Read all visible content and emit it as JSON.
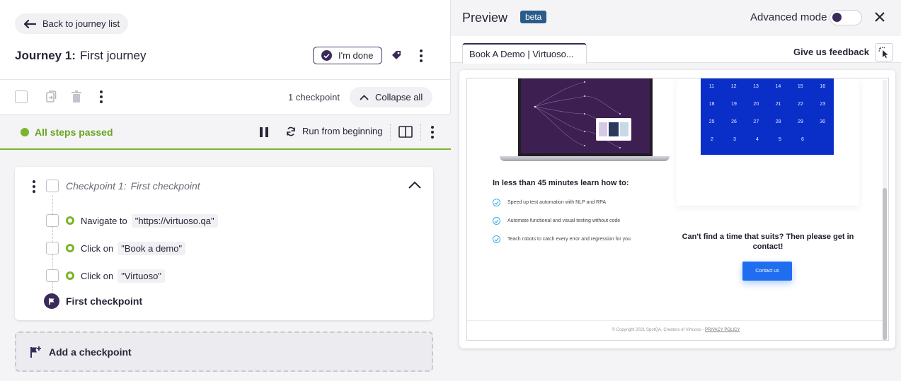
{
  "left": {
    "back_label": "Back to journey list",
    "journey_prefix": "Journey 1:",
    "journey_name": "First journey",
    "done_label": "I'm done",
    "checkpoint_count": "1 checkpoint",
    "collapse_label": "Collapse all",
    "status": {
      "text": "All steps passed",
      "color": "#7ab52a"
    },
    "run_label": "Run from beginning",
    "checkpoint": {
      "prefix": "Checkpoint 1:",
      "name": "First checkpoint",
      "steps": [
        {
          "action": "Navigate to",
          "target": "\"https://virtuoso.qa\""
        },
        {
          "action": "Click on",
          "target": "\"Book a demo\""
        },
        {
          "action": "Click on",
          "target": "\"Virtuoso\""
        }
      ],
      "flag_label": "First checkpoint"
    },
    "add_checkpoint_label": "Add a checkpoint"
  },
  "preview": {
    "title": "Preview",
    "badge": "beta",
    "advanced_mode_label": "Advanced mode",
    "advanced_mode_on": false,
    "tab_label": "Book A Demo | Virtuoso...",
    "feedback_label": "Give us feedback",
    "page": {
      "calendar_rows": [
        [
          "11",
          "12",
          "13",
          "14",
          "15",
          "16"
        ],
        [
          "18",
          "19",
          "20",
          "21",
          "22",
          "23"
        ],
        [
          "25",
          "26",
          "27",
          "28",
          "29",
          "30"
        ],
        [
          "2",
          "3",
          "4",
          "5",
          "6",
          ""
        ]
      ],
      "learn_title": "In less than 45 minutes learn how to:",
      "learn_items": [
        "Speed up test automation with NLP and RPA",
        "Automate functional and visual testing without code",
        "Teach robots to catch every error and regression for you"
      ],
      "cant_find": "Can't find a time that suits? Then please get in contact!",
      "contact_button": "Contact us",
      "copyright": "© Copyright 2021 SpotQA. Creators of Virtuoso -",
      "privacy": "PRIVACY POLICY"
    }
  },
  "colors": {
    "brand": "#3a2a5a",
    "success": "#7ab52a",
    "beta_badge": "#2a5c8a",
    "calendar": "#0a2fc9"
  },
  "icons": [
    "arrow-left-icon",
    "check-circle-icon",
    "tag-icon",
    "kebab-icon",
    "copy-icon",
    "trash-icon",
    "chevron-up-icon",
    "pause-icon",
    "refresh-icon",
    "split-view-icon",
    "flag-icon",
    "add-flag-icon",
    "close-icon",
    "element-picker-icon"
  ]
}
